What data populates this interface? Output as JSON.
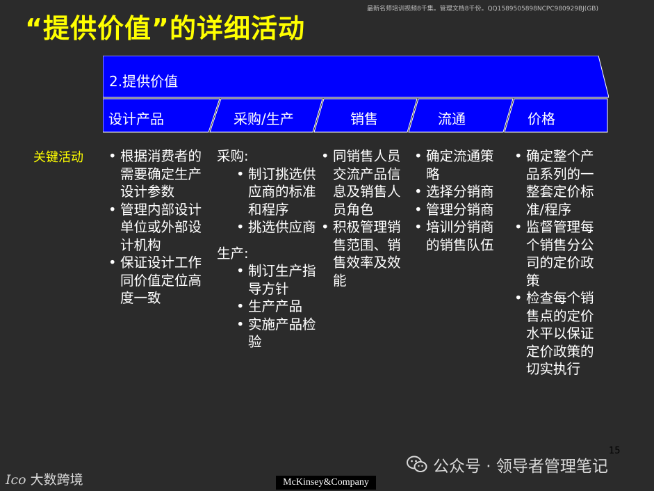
{
  "title": "“提供价值”的详细活动",
  "watermark_top": "最新名师培训视频8千集。管理文档8千份。QQ1589505898NCPC980929BJ(GB)",
  "banner": {
    "title": "2.提供价值",
    "segments": [
      "设计产品",
      "采购/生产",
      "销售",
      "流通",
      "价格"
    ]
  },
  "row_label": "关键活动",
  "columns": {
    "design": {
      "items": [
        [
          "根据消费者的",
          "需要确定生产",
          "设计参数"
        ],
        [
          "管理内部设计",
          "单位或外部设",
          "计机构"
        ],
        [
          "保证设计工作",
          "同价值定位高",
          "度一致"
        ]
      ]
    },
    "procure": {
      "procurement_heading": "采购:",
      "procurement_items": [
        [
          "制订挑选供",
          "应商的标准",
          "和程序"
        ],
        [
          "挑选供应商"
        ]
      ],
      "production_heading": "生产:",
      "production_items": [
        [
          "制订生产指",
          "导方针"
        ],
        [
          "生产产品"
        ],
        [
          "实施产品检",
          "验"
        ]
      ]
    },
    "sales": {
      "items": [
        [
          "同销售人员",
          "交流产品信",
          "息及销售人",
          "员角色"
        ],
        [
          "积极管理销",
          "售范围、销",
          "售效率及效",
          "能"
        ]
      ]
    },
    "distribution": {
      "items": [
        [
          "确定流通策",
          "略"
        ],
        [
          "选择分销商"
        ],
        [
          "管理分销商"
        ],
        [
          "培训分销商",
          "的销售队伍"
        ]
      ]
    },
    "pricing": {
      "items": [
        [
          "确定整个产",
          "品系列的一",
          "整套定价标",
          "准/程序"
        ],
        [
          "监督管理每",
          "个销售分公",
          "司的定价政",
          "策"
        ],
        [
          "检查每个销",
          "售点的定价",
          "水平以保证",
          "定价政策的",
          "切实执行"
        ]
      ]
    }
  },
  "page_number": "15",
  "logo_left_text": "大数跨境",
  "logo_left_mark": "Ico",
  "footer_brand": "McKinsey&Company",
  "wechat_text": "公众号 · 领导者管理笔记",
  "colors": {
    "banner_blue": "#0000ff",
    "title_yellow": "#ffff00",
    "background": "#2b2b2b"
  },
  "icons": [
    "wechat-icon"
  ]
}
